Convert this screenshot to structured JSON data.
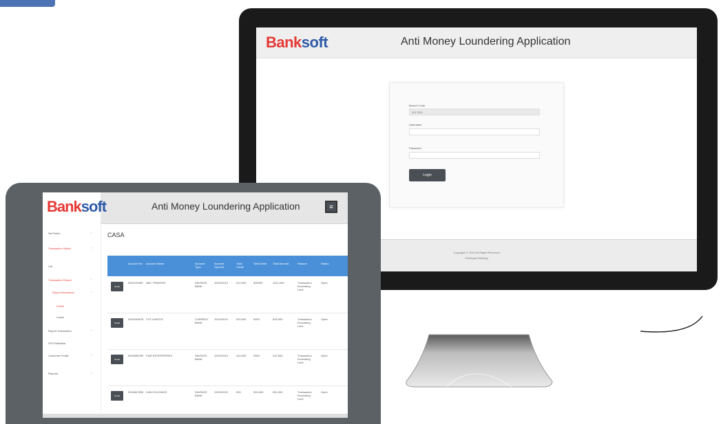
{
  "colors": {
    "brand_blue": "#2e5aa8",
    "brand_red": "#e53935",
    "accent_blue": "#4a90d9",
    "device_dark": "#1a1a1a",
    "tablet_gray": "#5c6166"
  },
  "desktop": {
    "logo_bank": "Bank",
    "logo_soft": "soft",
    "title": "Anti Money Loundering Application",
    "login": {
      "branch_label": "Branch Code",
      "branch_value": "001 PAD",
      "username_label": "Username",
      "password_label": "Password",
      "login_button": "Login"
    },
    "footer": {
      "line1": "Copyright © 2019 All Rights Reserved",
      "line2": "Privileged Banking"
    }
  },
  "tablet": {
    "logo_bank": "Bank",
    "logo_soft": "soft",
    "title": "Anti Money Loundering Application",
    "menu_icon": "menu-icon",
    "page_heading": "CASA",
    "sidebar": [
      {
        "label": "Set Rules",
        "red": false
      },
      {
        "label": "Transaction Watch",
        "red": true
      },
      {
        "label": "List",
        "red": false
      },
      {
        "label": "Transaction Report",
        "red": true
      },
      {
        "label": "Report Assurance",
        "red": true
      },
      {
        "label": "CASA",
        "red": true
      },
      {
        "label": "Loans",
        "red": false
      },
      {
        "label": "Report Transaction",
        "red": false
      },
      {
        "label": "STR Watchlist",
        "red": false
      },
      {
        "label": "Customer Profile",
        "red": false
      },
      {
        "label": "Reports",
        "red": false
      }
    ],
    "table": {
      "headers": [
        "Account No",
        "Account Name",
        "Account Type",
        "Account Opened",
        "Total Credit",
        "Total Debit",
        "Total Amount",
        "Reason",
        "Status"
      ],
      "rows": [
        {
          "action": "Detail",
          "cells": [
            "0001234567",
            "ABC TRADERS",
            "SAVINGS BANK",
            "10/04/2019",
            "512,000",
            "500000",
            "1012,000",
            "Transaction Exceeding Limit",
            "Open"
          ]
        },
        {
          "action": "Detail",
          "cells": [
            "0002345678",
            "XYZ LIMITED",
            "CURRENT BANK",
            "11/04/2019",
            "620,000",
            "5000",
            "625,000",
            "Transaction Exceeding Limit",
            "Open"
          ]
        },
        {
          "action": "Detail",
          "cells": [
            "0003456789",
            "PQR ENTERPRISES",
            "SAVINGS BANK",
            "12/04/2019",
            "410,000",
            "2500",
            "412,500",
            "Transaction Exceeding Limit",
            "Open"
          ]
        },
        {
          "action": "Detail",
          "cells": [
            "0004567890",
            "LMN HOLDINGS",
            "SAVINGS BANK",
            "13/04/2019",
            "300",
            "900,000",
            "900,300",
            "Transaction Exceeding Limit",
            "Open"
          ]
        }
      ]
    }
  }
}
